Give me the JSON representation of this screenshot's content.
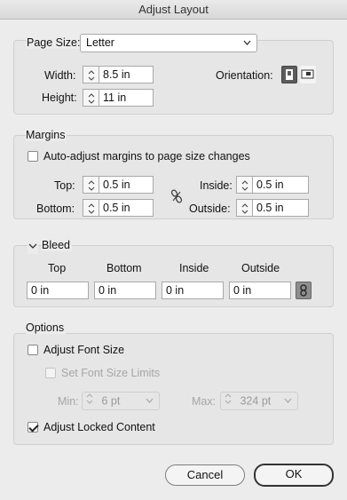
{
  "window": {
    "title": "Adjust Layout"
  },
  "page": {
    "size_label": "Page Size:",
    "size_value": "Letter",
    "width_label": "Width:",
    "width_value": "8.5 in",
    "height_label": "Height:",
    "height_value": "11 in",
    "orientation_label": "Orientation:"
  },
  "margins": {
    "section_label": "Margins",
    "auto_adjust_label": "Auto-adjust margins to page size changes",
    "auto_adjust_checked": false,
    "top_label": "Top:",
    "top_value": "0.5 in",
    "bottom_label": "Bottom:",
    "bottom_value": "0.5 in",
    "inside_label": "Inside:",
    "inside_value": "0.5 in",
    "outside_label": "Outside:",
    "outside_value": "0.5 in"
  },
  "bleed": {
    "section_label": "Bleed",
    "top_label": "Top",
    "bottom_label": "Bottom",
    "inside_label": "Inside",
    "outside_label": "Outside",
    "top_value": "0 in",
    "bottom_value": "0 in",
    "inside_value": "0 in",
    "outside_value": "0 in"
  },
  "options": {
    "section_label": "Options",
    "adjust_font_size_label": "Adjust Font Size",
    "adjust_font_size_checked": false,
    "set_font_limits_label": "Set Font Size Limits",
    "set_font_limits_checked": false,
    "min_label": "Min:",
    "min_value": "6 pt",
    "max_label": "Max:",
    "max_value": "324 pt",
    "adjust_locked_label": "Adjust Locked Content",
    "adjust_locked_checked": true
  },
  "buttons": {
    "cancel": "Cancel",
    "ok": "OK"
  }
}
